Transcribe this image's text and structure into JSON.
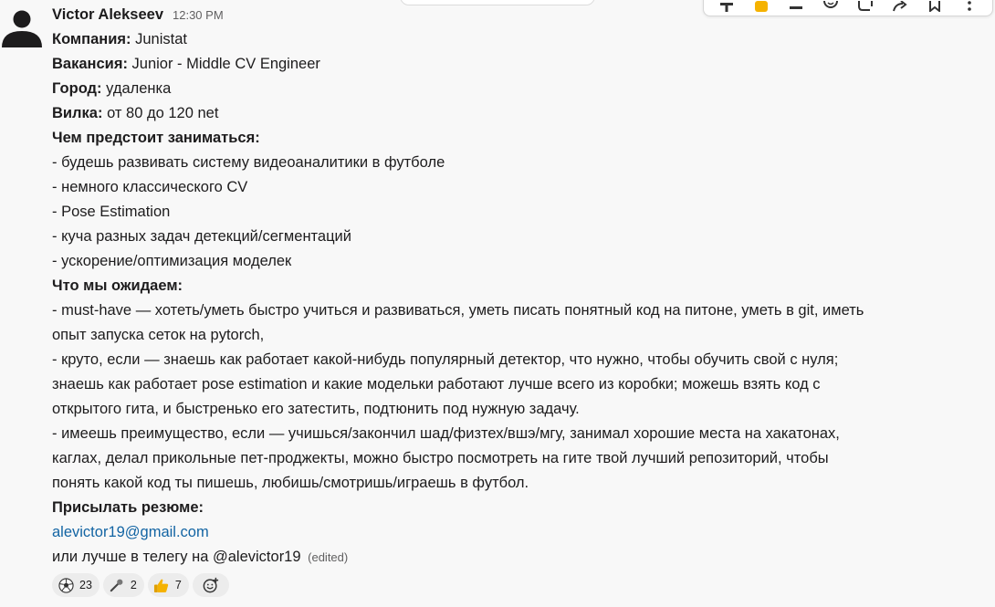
{
  "message": {
    "author": "Victor Alekseev",
    "time": "12:30 PM",
    "lines": [
      {
        "label": "Компания:",
        "text": " Junistat"
      },
      {
        "label": "Вакансия:",
        "text": " Junior - Middle CV Engineer"
      },
      {
        "label": "Город:",
        "text": " удаленка"
      },
      {
        "label": "Вилка:",
        "text": " от 80 до 120 net"
      },
      {
        "label": "Чем предстоит заниматься:",
        "text": ""
      },
      {
        "label": "",
        "text": "- будешь развивать систему видеоаналитики в футболе"
      },
      {
        "label": "",
        "text": "- немного классического CV"
      },
      {
        "label": "",
        "text": "- Pose Estimation"
      },
      {
        "label": "",
        "text": "- куча разных задач детекций/сегментаций"
      },
      {
        "label": "",
        "text": "- ускорение/оптимизация моделек"
      },
      {
        "label": "Что мы ожидаем:",
        "text": ""
      },
      {
        "label": "",
        "text": "- must-have — хотеть/уметь быстро учиться и развиваться, уметь писать понятный код на питоне, уметь в git, иметь"
      },
      {
        "label": "",
        "text": "опыт запуска сеток на pytorch,"
      },
      {
        "label": "",
        "text": "- круто, если — знаешь как работает какой-нибудь популярный детектор, что нужно, чтобы обучить свой с нуля;"
      },
      {
        "label": "",
        "text": "знаешь как работает pose estimation и какие модельки работают лучше всего из коробки; можешь взять код с"
      },
      {
        "label": "",
        "text": "открытого гита, и быстренько его затестить, подтюнить под нужную задачу."
      },
      {
        "label": "",
        "text": "- имеешь преимущество, если — учишься/закончил шад/физтех/вшэ/мгу, занимал хорошие места на хакатонах,"
      },
      {
        "label": "",
        "text": "каглах, делал прикольные пет-проджекты, можно быстро посмотреть на гите твой лучший репозиторий, чтобы"
      },
      {
        "label": "",
        "text": "понять какой код ты пишешь, любишь/смотришь/играешь в футбол."
      },
      {
        "label": "Присылать резюме:",
        "text": ""
      }
    ],
    "email": "alevictor19@gmail.com",
    "last_line": "или лучше в телегу на @alevictor19",
    "edited": "(edited)"
  },
  "reactions": [
    {
      "icon": "soccer-ball-icon",
      "count": "23"
    },
    {
      "icon": "microphone-icon",
      "count": "2"
    },
    {
      "icon": "thumbs-up-icon",
      "count": "7"
    }
  ],
  "toolbar": {
    "icons": [
      "plus-icon",
      "thumbs-up-icon",
      "minus-icon",
      "emoji-icon",
      "comment-icon",
      "share-icon",
      "bookmark-icon",
      "more-icon"
    ]
  },
  "colors": {
    "link": "#1264a3",
    "background": "#f8f8f8",
    "reaction_bg": "#ececec"
  }
}
